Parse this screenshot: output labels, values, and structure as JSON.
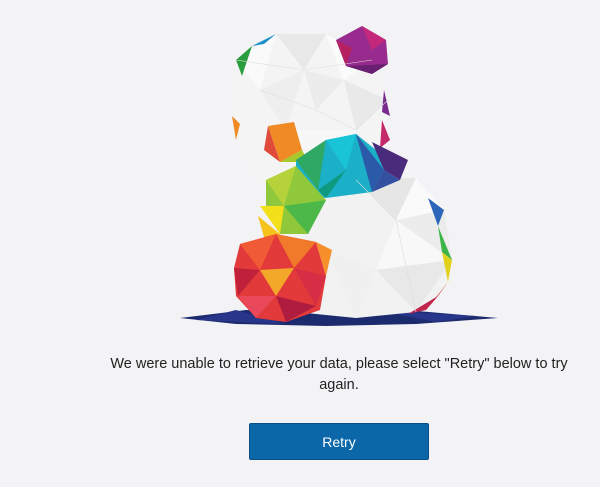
{
  "illustration": {
    "icon": "low-poly-rainbow-panda-icon",
    "colors": {
      "body": "#f4f4f4",
      "shadow": "#1a2a6c",
      "accent_red": "#d6303e",
      "accent_orange": "#f08a24",
      "accent_yellow": "#f4e01a",
      "accent_green": "#33b56a",
      "accent_teal": "#1cc4c9",
      "accent_blue": "#2a5aa8",
      "accent_purple": "#7a2a8c",
      "accent_magenta": "#c4256a"
    }
  },
  "error": {
    "message": "We were unable to retrieve your data, please select \"Retry\" below to try again."
  },
  "actions": {
    "retry_label": "Retry",
    "button_color": "#0b67a8"
  }
}
